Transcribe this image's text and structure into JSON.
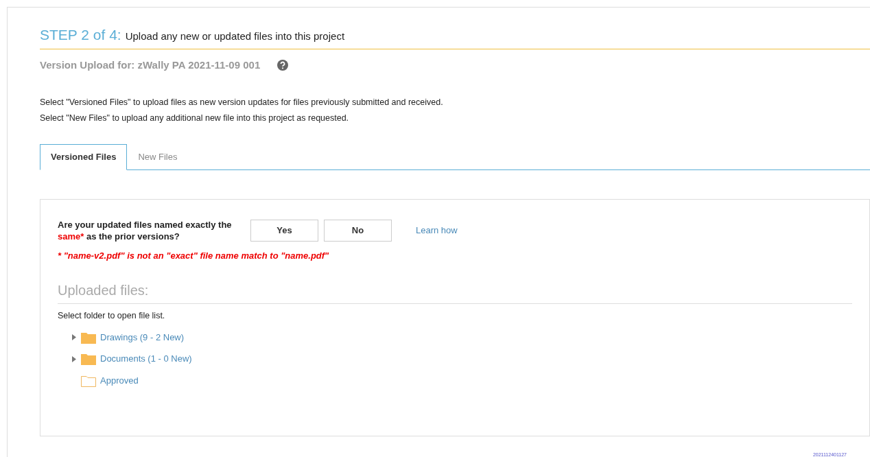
{
  "step": {
    "label": "STEP 2 of 4:",
    "title": "Upload any new or updated files into this project"
  },
  "version_upload": "Version Upload for: zWally PA 2021-11-09 001",
  "instructions": [
    "Select \"Versioned Files\" to upload files as new version updates for files previously submitted and received.",
    "Select \"New Files\" to upload any additional new file into this project as requested."
  ],
  "tabs": [
    {
      "label": "Versioned Files",
      "selected": true
    },
    {
      "label": "New Files",
      "selected": false
    }
  ],
  "question": {
    "before": "Are your updated files named exactly the ",
    "highlight": "same*",
    "after": " as the prior versions?"
  },
  "buttons": [
    "Yes",
    "No"
  ],
  "learn_link": "Learn how",
  "note": "* \"name-v2.pdf\" is not an \"exact\" file name match to \"name.pdf\"",
  "uploaded": {
    "heading": "Uploaded files:",
    "hint": "Select folder to open file list.",
    "folders": [
      {
        "label": "Drawings (9 - 2 New)",
        "expandable": true,
        "kind": "filled"
      },
      {
        "label": "Documents (1 - 0 New)",
        "expandable": true,
        "kind": "filled"
      },
      {
        "label": "Approved",
        "expandable": false,
        "kind": "empty"
      }
    ]
  },
  "footer_code": "2021112401127"
}
